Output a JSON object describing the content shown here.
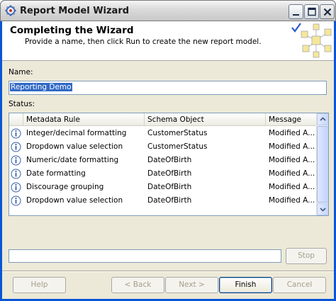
{
  "window": {
    "title": "Report Model Wizard"
  },
  "header": {
    "title": "Completing the Wizard",
    "subtitle": "Provide a name, then click Run to create the new report model."
  },
  "name": {
    "label": "Name:",
    "value": "Reporting Demo"
  },
  "status": {
    "label": "Status:",
    "columns": [
      "Metadata Rule",
      "Schema Object",
      "Message"
    ],
    "rows": [
      {
        "icon": "info-icon",
        "rule": "Integer/decimal formatting",
        "object": "CustomerStatus",
        "message": "Modified A..."
      },
      {
        "icon": "info-icon",
        "rule": "Dropdown value selection",
        "object": "CustomerStatus",
        "message": "Modified A..."
      },
      {
        "icon": "info-icon",
        "rule": "Numeric/date formatting",
        "object": "DateOfBirth",
        "message": "Modified A..."
      },
      {
        "icon": "info-icon",
        "rule": "Date formatting",
        "object": "DateOfBirth",
        "message": "Modified A..."
      },
      {
        "icon": "info-icon",
        "rule": "Discourage grouping",
        "object": "DateOfBirth",
        "message": "Modified A..."
      },
      {
        "icon": "info-icon",
        "rule": "Dropdown value selection",
        "object": "DateOfBirth",
        "message": "Modified A..."
      }
    ]
  },
  "progress": {
    "value": 0,
    "stop_label": "Stop"
  },
  "buttons": {
    "help": "Help",
    "back": "< Back",
    "next": "Next >",
    "finish": "Finish",
    "cancel": "Cancel"
  },
  "colors": {
    "title_bar": "#dcdcdc",
    "dialog_face": "#ece9d8",
    "selection": "#316ac5",
    "info_icon": "#3b5ea8"
  }
}
